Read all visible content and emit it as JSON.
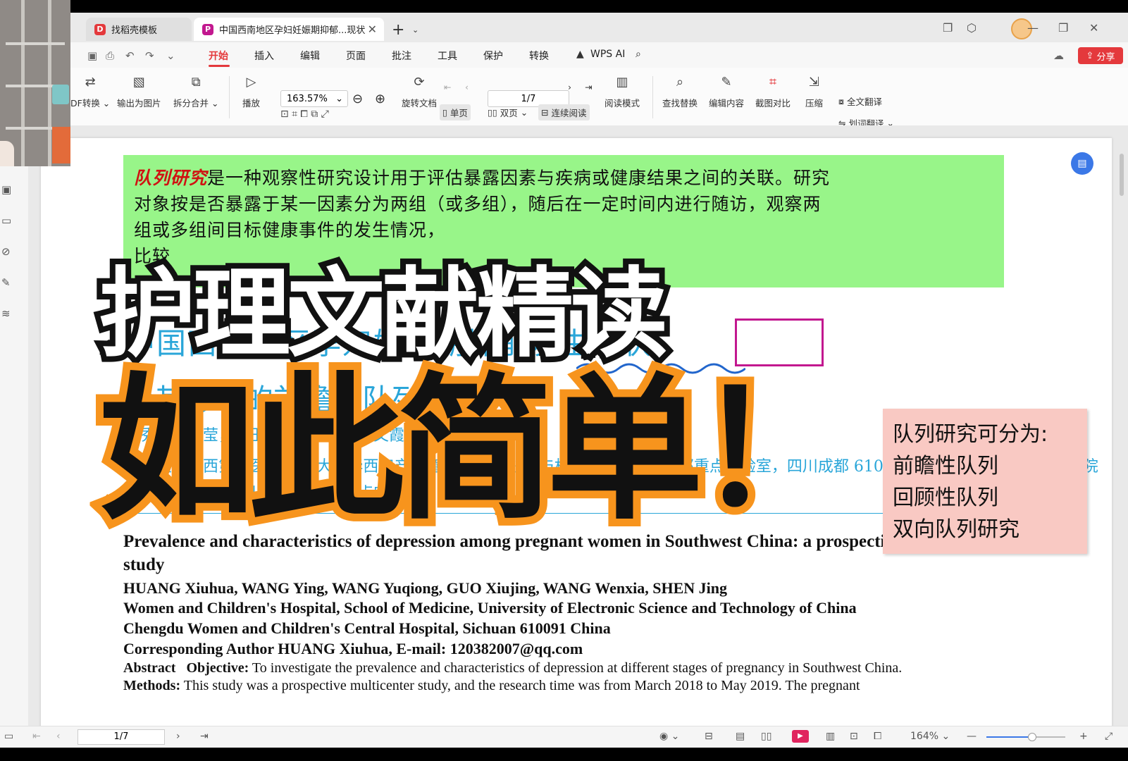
{
  "tabs": [
    {
      "label": "找稻壳模板",
      "icon": "docer-icon",
      "active": false
    },
    {
      "label": "中国西南地区孕妇妊娠期抑郁...现状",
      "icon": "pdf-icon",
      "active": true
    }
  ],
  "menu": {
    "items": [
      "开始",
      "插入",
      "编辑",
      "页面",
      "批注",
      "工具",
      "保护",
      "转换",
      "WPS AI"
    ],
    "active": "开始",
    "share_label": "分享"
  },
  "toolbar": {
    "pdf_convert": "DF转换",
    "export_image": "输出为图片",
    "split_merge": "拆分合并",
    "play": "播放",
    "zoom": "163.57%",
    "page": "1/7",
    "rotate": "旋转文档",
    "single_page": "单页",
    "double_page": "双页",
    "continuous": "连续阅读",
    "read_mode": "阅读模式",
    "find_replace": "查找替换",
    "edit_content": "编辑内容",
    "screenshot_compare": "截图对比",
    "compress": "压缩",
    "full_translate": "全文翻译",
    "word_translate": "划词翻译"
  },
  "document": {
    "green_note_lead": "队列研究",
    "green_note_line1": "是一种观察性研究设计用于评估暴露因素与疾病或健康结果之间的关联。研究",
    "green_note_line2": "对象按是否暴露于某一因素分为两组（或多组），随后在一定时间内进行随访，观察两",
    "green_note_line3": "组或多组间目标健康事件的发生情况，",
    "green_note_line4": "比较",
    "cn_title_line1": "中国西南地区孕妇妊娠期抑郁发生现状",
    "cn_title_line2": "及其影响的前瞻性队列",
    "cn_authors": "黄秀华，王莹，王玉琼，郭秀静，王文霞，沈静",
    "cn_affil_line1": "四川大学华西第二医院/四川大学华西妇产儿童医院/出生缺陷与相关妇儿疾病教育部重点实验室，四川成都 610041；2.四川大学华西第二医院",
    "cn_affil_line2": "出生缺陷与相关妇儿疾病教育部重点实验室",
    "en_title": "Prevalence and characteristics of depression among pregnant women in Southwest China: a prospective cohort study",
    "en_authors": "HUANG  Xiuhua, WANG  Ying, WANG  Yuqiong, GUO  Xiujing, WANG  Wenxia, SHEN  Jing",
    "en_affil1": "Women and Children's Hospital, School of Medicine, University of Electronic Science and Technology of China",
    "en_affil2": "Chengdu Women and Children's Central Hospital, Sichuan 610091 China",
    "en_corresponding": "Corresponding Author    HUANG Xiuhua, E-mail: 120382007@qq.com",
    "abstract_label": "Abstract",
    "objective_label": "Objective:",
    "objective_text": " To investigate the prevalence and characteristics of depression at different stages of pregnancy in Southwest China.",
    "methods_label": "Methods:",
    "methods_text": " This study was a prospective multicenter study, and the research time was from March 2018 to May 2019. The pregnant"
  },
  "pink_note": {
    "lines": [
      "队列研究可分为:",
      "前瞻性队列",
      "回顾性队列",
      "双向队列研究"
    ]
  },
  "overlay": {
    "line1": "护理文献精读",
    "line2": "如此简单！"
  },
  "statusbar": {
    "page": "1/7",
    "zoom": "164%"
  },
  "colors": {
    "accent": "#e4393c",
    "doc_blue": "#2aa6d9",
    "highlight_green": "#98f589",
    "note_pink": "#f9c9c3",
    "overlay_orange": "#f7941d"
  }
}
